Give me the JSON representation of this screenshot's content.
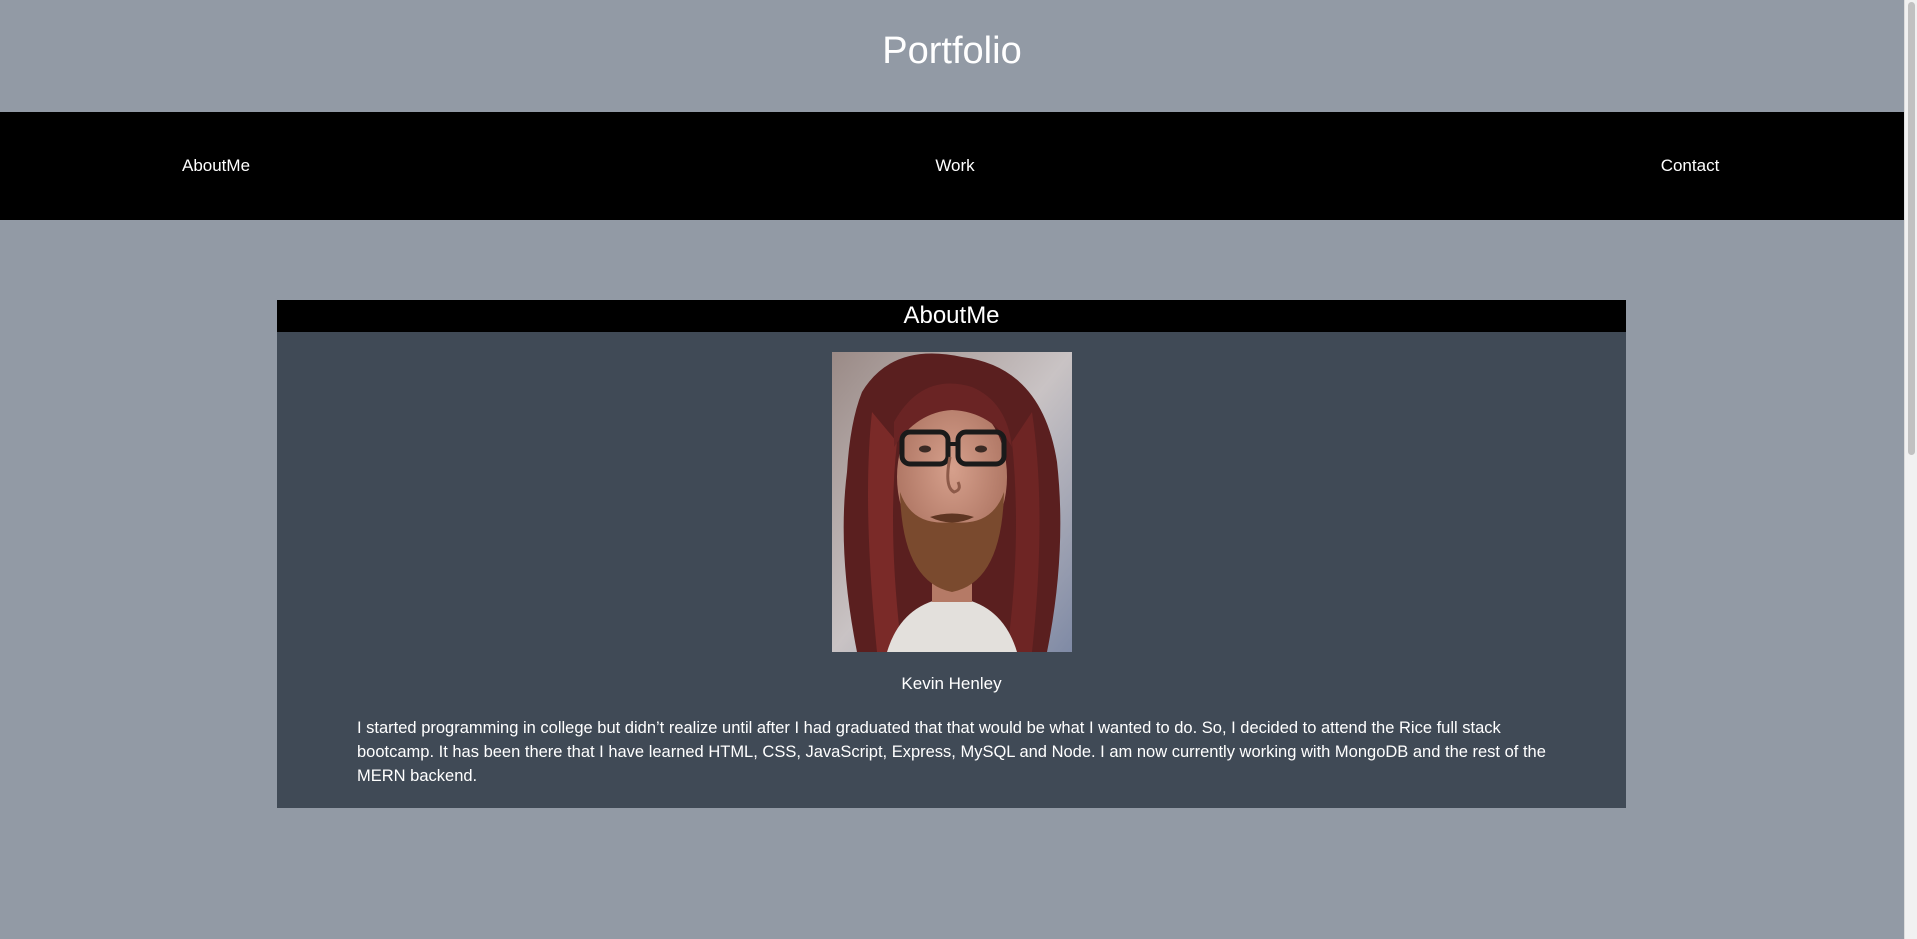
{
  "header": {
    "title": "Portfolio"
  },
  "nav": {
    "items": [
      {
        "label": "AboutMe"
      },
      {
        "label": "Work"
      },
      {
        "label": "Contact"
      }
    ]
  },
  "about": {
    "title": "AboutMe",
    "name": "Kevin Henley",
    "bio": "I started programming in college but didn’t realize until after I had graduated that that would be what I wanted to do. So, I decided to attend the Rice full stack bootcamp. It has been there that I have learned HTML, CSS, JavaScript, Express, MySQL and Node. I am now currently working with MongoDB and the rest of the MERN backend."
  },
  "colors": {
    "page_background": "#929aa5",
    "nav_background": "#000000",
    "card_background": "#404a56",
    "text": "#ffffff"
  }
}
